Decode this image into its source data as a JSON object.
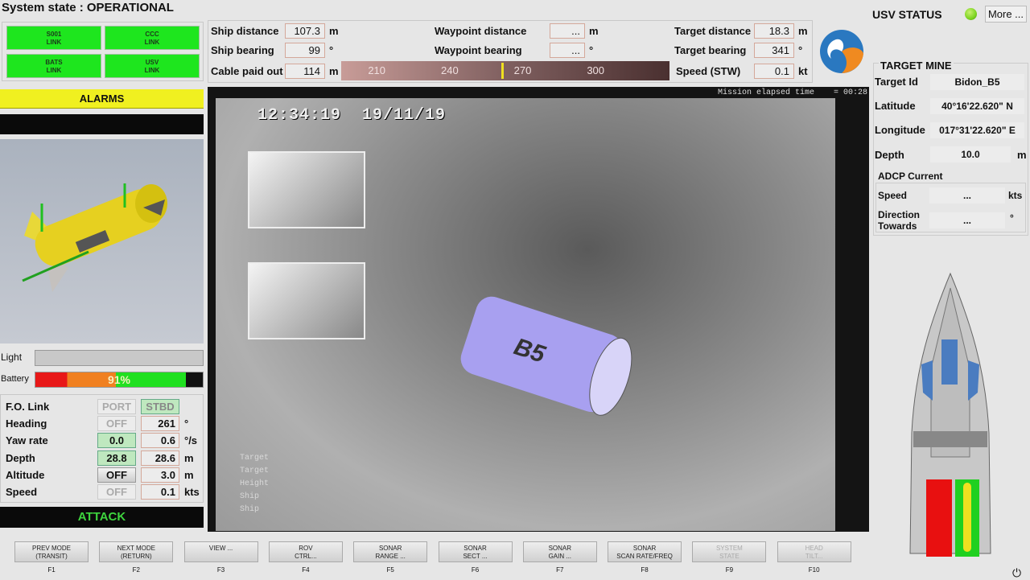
{
  "system_state": "System state : OPERATIONAL",
  "links": [
    {
      "l1": "S001",
      "l2": "LINK"
    },
    {
      "l1": "CCC",
      "l2": "LINK"
    },
    {
      "l1": "BATS",
      "l2": "LINK"
    },
    {
      "l1": "USV",
      "l2": "LINK"
    }
  ],
  "alarms": "ALARMS",
  "light_label": "Light",
  "battery": {
    "label": "Battery",
    "percent": 91,
    "text": "91%"
  },
  "vehicle": {
    "fo_link": {
      "label": "F.O. Link",
      "port": "PORT",
      "stbd": "STBD"
    },
    "rows": [
      {
        "label": "Heading",
        "mode": "OFF",
        "value": "261",
        "unit": "°"
      },
      {
        "label": "Yaw rate",
        "mode": "0.0",
        "value": "0.6",
        "unit": "°/s"
      },
      {
        "label": "Depth",
        "mode": "28.8",
        "value": "28.6",
        "unit": "m"
      },
      {
        "label": "Altitude",
        "mode": "OFF",
        "value": "3.0",
        "unit": "m"
      },
      {
        "label": "Speed",
        "mode": "OFF",
        "value": "0.1",
        "unit": "kts"
      }
    ]
  },
  "attack": "ATTACK",
  "nav": {
    "ship_distance": {
      "label": "Ship distance",
      "value": "107.3",
      "unit": "m"
    },
    "ship_bearing": {
      "label": "Ship bearing",
      "value": "99",
      "unit": "°"
    },
    "cable": {
      "label": "Cable paid out",
      "value": "114",
      "unit": "m"
    },
    "wp_distance": {
      "label": "Waypoint distance",
      "value": "...",
      "unit": "m"
    },
    "wp_bearing": {
      "label": "Waypoint bearing",
      "value": "...",
      "unit": "°"
    },
    "target_distance": {
      "label": "Target distance",
      "value": "18.3",
      "unit": "m"
    },
    "target_bearing": {
      "label": "Target bearing",
      "value": "341",
      "unit": "°"
    },
    "speed": {
      "label": "Speed (STW)",
      "value": "0.1",
      "unit": "kt"
    },
    "compass_ticks": [
      "210",
      "240",
      "270",
      "300"
    ],
    "heading_marker": 261
  },
  "video": {
    "mission_time": "Mission elapsed time    = 00:28",
    "timestamp": "12:34:19  19/11/19",
    "mine_label": "B5",
    "overlay": [
      "Target",
      "Target",
      "Height",
      "Ship",
      "Ship"
    ]
  },
  "usv": {
    "title": "USV STATUS",
    "status_color": "#7cd420",
    "more": "More ..."
  },
  "target_mine": {
    "title": "TARGET MINE",
    "id_label": "Target Id",
    "id": "Bidon_B5",
    "lat_label": "Latitude",
    "lat": "40°16'22.620\" N",
    "lon_label": "Longitude",
    "lon": "017°31'22.620\" E",
    "depth_label": "Depth",
    "depth": "10.0",
    "depth_unit": "m",
    "adcp": {
      "title": "ADCP Current",
      "speed_label": "Speed",
      "speed": "...",
      "speed_unit": "kts",
      "dir_label": "Direction Towards",
      "dir": "...",
      "dir_unit": "°"
    }
  },
  "fkeys": [
    {
      "l1": "PREV MODE",
      "l2": "(TRANSIT)",
      "key": "F1"
    },
    {
      "l1": "NEXT MODE",
      "l2": "(RETURN)",
      "key": "F2"
    },
    {
      "l1": "VIEW ...",
      "l2": "",
      "key": "F3"
    },
    {
      "l1": "ROV",
      "l2": "CTRL...",
      "key": "F4"
    },
    {
      "l1": "SONAR",
      "l2": "RANGE ...",
      "key": "F5"
    },
    {
      "l1": "SONAR",
      "l2": "SECT ...",
      "key": "F6"
    },
    {
      "l1": "SONAR",
      "l2": "GAIN ...",
      "key": "F7"
    },
    {
      "l1": "SONAR",
      "l2": "SCAN RATE/FREQ",
      "key": "F8"
    },
    {
      "l1": "SYSTEM",
      "l2": "STATE",
      "key": "F9",
      "disabled": true
    },
    {
      "l1": "HEAD",
      "l2": "TILT...",
      "key": "F10",
      "disabled": true
    }
  ]
}
